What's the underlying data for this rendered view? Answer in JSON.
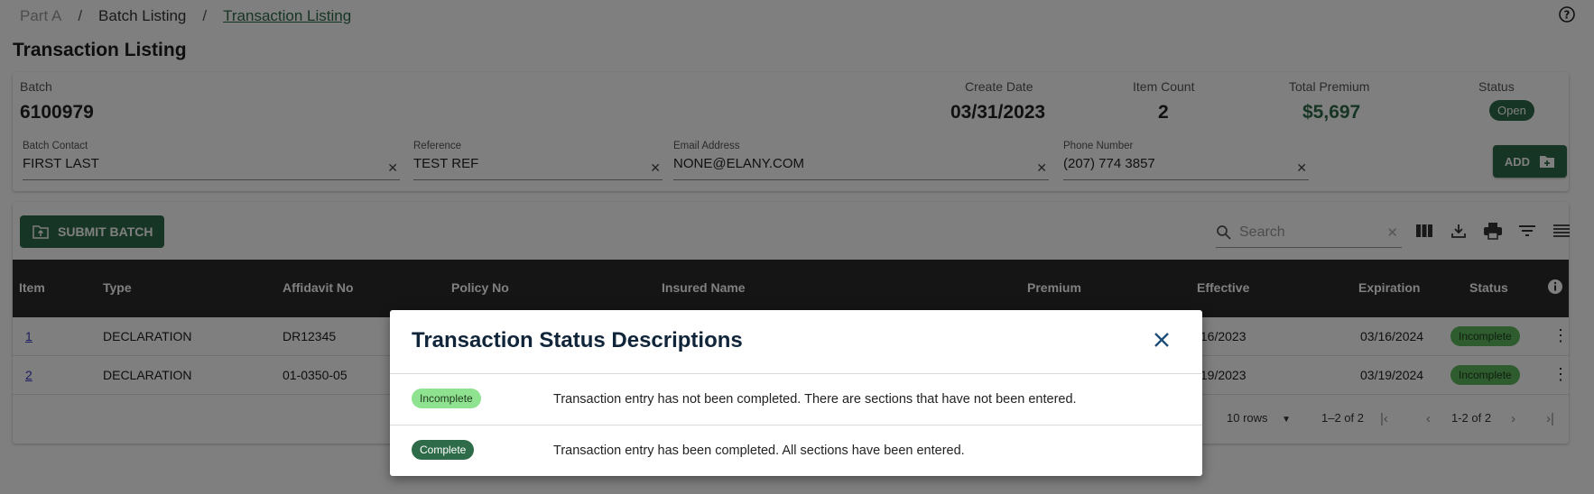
{
  "breadcrumb": {
    "part": "Part A",
    "batch_listing": "Batch Listing",
    "current": "Transaction Listing"
  },
  "page_title": "Transaction Listing",
  "batch": {
    "label": "Batch",
    "value": "6100979",
    "create_date_label": "Create Date",
    "create_date": "03/31/2023",
    "item_count_label": "Item Count",
    "item_count": "2",
    "total_premium_label": "Total Premium",
    "total_premium": "$5,697",
    "status_label": "Status",
    "status": "Open"
  },
  "fields": {
    "contact": {
      "label": "Batch Contact",
      "value": "FIRST LAST"
    },
    "reference": {
      "label": "Reference",
      "value": "TEST REF"
    },
    "email": {
      "label": "Email Address",
      "value": "NONE@ELANY.COM"
    },
    "phone": {
      "label": "Phone Number",
      "value": "(207) 774 3857"
    }
  },
  "add_label": "ADD",
  "submit_label": "SUBMIT BATCH",
  "search": {
    "placeholder": "Search"
  },
  "table": {
    "headers": [
      "Item",
      "Type",
      "Affidavit No",
      "Policy No",
      "Insured Name",
      "Premium",
      "Effective",
      "Expiration",
      "Status"
    ],
    "rows": [
      {
        "item": "1",
        "type": "DECLARATION",
        "affidavit": "DR12345",
        "effective": "/16/2023",
        "expiration": "03/16/2024",
        "status": "Incomplete"
      },
      {
        "item": "2",
        "type": "DECLARATION",
        "affidavit": "01-0350-05",
        "effective": "/19/2023",
        "expiration": "03/19/2024",
        "status": "Incomplete"
      }
    ]
  },
  "pager": {
    "rows": "10 rows",
    "range": "1–2 of 2",
    "page": "1-2 of 2"
  },
  "modal": {
    "title": "Transaction Status Descriptions",
    "items": [
      {
        "status": "Incomplete",
        "description": "Transaction entry has not been completed. There are sections that have not been entered."
      },
      {
        "status": "Complete",
        "description": "Transaction entry has been completed. All sections have been entered."
      }
    ]
  },
  "colors": {
    "accent": "#2e6b48",
    "table_header": "#2b2b2b",
    "incomplete": "#5cb85c"
  }
}
